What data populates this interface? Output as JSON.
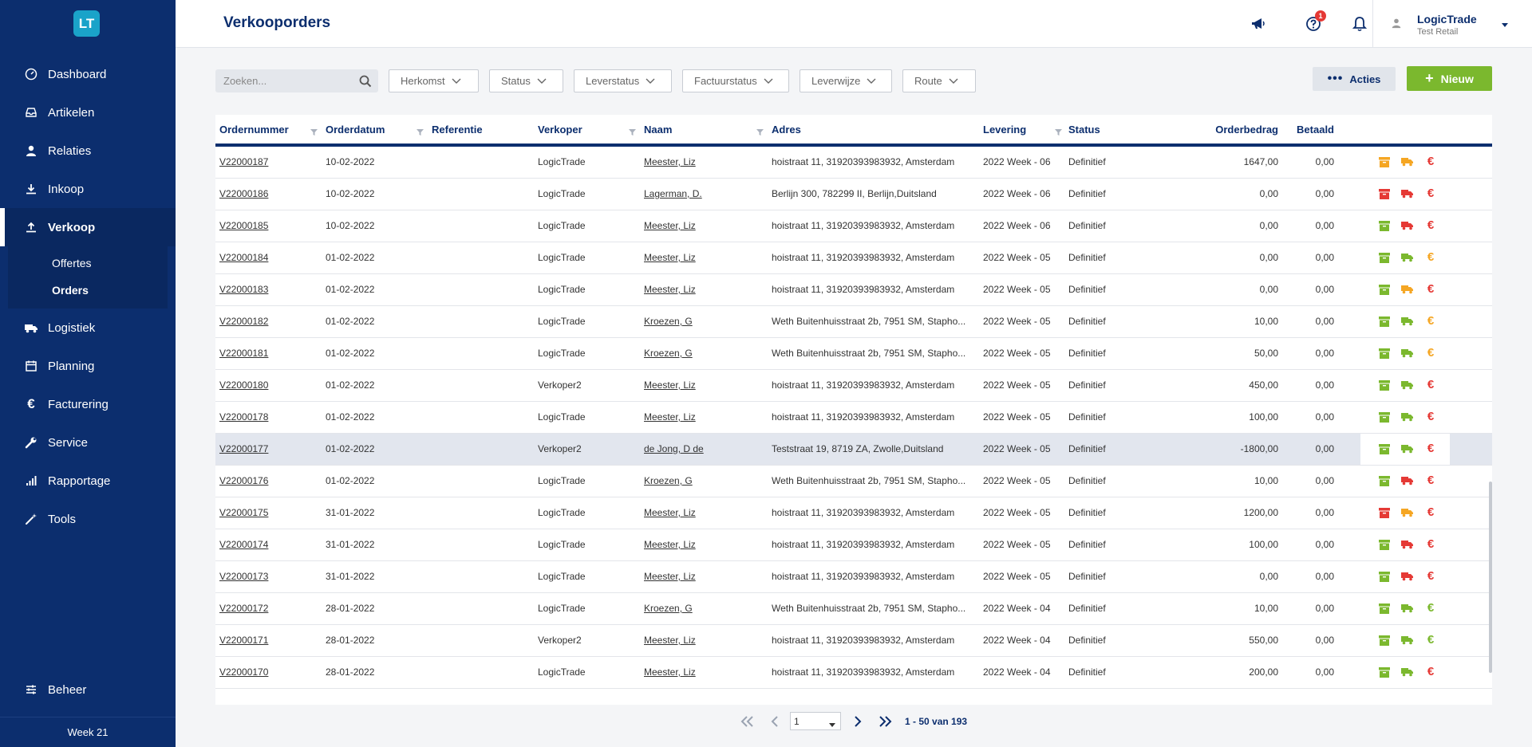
{
  "app": {
    "logo": "LT",
    "page_title": "Verkooporders",
    "week": "Week 21"
  },
  "sidebar": {
    "items": [
      {
        "label": "Dashboard",
        "icon": "dashboard-icon"
      },
      {
        "label": "Artikelen",
        "icon": "inbox-icon"
      },
      {
        "label": "Relaties",
        "icon": "user-icon"
      },
      {
        "label": "Inkoop",
        "icon": "download-icon"
      },
      {
        "label": "Verkoop",
        "icon": "upload-icon"
      }
    ],
    "sub": [
      {
        "label": "Offertes"
      },
      {
        "label": "Orders"
      }
    ],
    "items2": [
      {
        "label": "Logistiek",
        "icon": "truck-icon"
      },
      {
        "label": "Planning",
        "icon": "calendar-icon"
      },
      {
        "label": "Facturering",
        "icon": "euro-icon"
      },
      {
        "label": "Service",
        "icon": "wrench-icon"
      },
      {
        "label": "Rapportage",
        "icon": "bar-chart-icon"
      },
      {
        "label": "Tools",
        "icon": "magic-wand-icon"
      }
    ],
    "beheer": "Beheer"
  },
  "topbar": {
    "help_badge": "1",
    "user_name": "LogicTrade",
    "user_sub": "Test Retail"
  },
  "filters": {
    "search_placeholder": "Zoeken...",
    "items": [
      "Herkomst",
      "Status",
      "Leverstatus",
      "Factuurstatus",
      "Leverwijze",
      "Route"
    ],
    "acties": "Acties",
    "nieuw": "Nieuw"
  },
  "table": {
    "headers": {
      "ordernummer": "Ordernummer",
      "orderdatum": "Orderdatum",
      "referentie": "Referentie",
      "verkoper": "Verkoper",
      "naam": "Naam",
      "adres": "Adres",
      "levering": "Levering",
      "status": "Status",
      "orderbedrag": "Orderbedrag",
      "betaald": "Betaald"
    },
    "rows": [
      {
        "nr": "V22000187",
        "datum": "10-02-2022",
        "verkoper": "LogicTrade",
        "naam": "Meester, Liz",
        "adres": "hoistraat 11, 31920393983932, Amsterdam",
        "levering": "2022 Week - 06",
        "status": "Definitief",
        "bedrag": "1647,00",
        "betaald": "0,00",
        "c": [
          "#f5a623",
          "#f5a623",
          "#e53935"
        ]
      },
      {
        "nr": "V22000186",
        "datum": "10-02-2022",
        "verkoper": "LogicTrade",
        "naam": "Lagerman, D.",
        "adres": "Berlijn 300, 782299 II, Berlijn,Duitsland",
        "levering": "2022 Week - 06",
        "status": "Definitief",
        "bedrag": "0,00",
        "betaald": "0,00",
        "c": [
          "#e53935",
          "#e53935",
          "#e53935"
        ]
      },
      {
        "nr": "V22000185",
        "datum": "10-02-2022",
        "verkoper": "LogicTrade",
        "naam": "Meester, Liz",
        "adres": "hoistraat 11, 31920393983932, Amsterdam",
        "levering": "2022 Week - 06",
        "status": "Definitief",
        "bedrag": "0,00",
        "betaald": "0,00",
        "c": [
          "#7bb82e",
          "#e53935",
          "#e53935"
        ]
      },
      {
        "nr": "V22000184",
        "datum": "01-02-2022",
        "verkoper": "LogicTrade",
        "naam": "Meester, Liz",
        "adres": "hoistraat 11, 31920393983932, Amsterdam",
        "levering": "2022 Week - 05",
        "status": "Definitief",
        "bedrag": "0,00",
        "betaald": "0,00",
        "c": [
          "#7bb82e",
          "#7bb82e",
          "#f5a623"
        ]
      },
      {
        "nr": "V22000183",
        "datum": "01-02-2022",
        "verkoper": "LogicTrade",
        "naam": "Meester, Liz",
        "adres": "hoistraat 11, 31920393983932, Amsterdam",
        "levering": "2022 Week - 05",
        "status": "Definitief",
        "bedrag": "0,00",
        "betaald": "0,00",
        "c": [
          "#7bb82e",
          "#f5a623",
          "#e53935"
        ]
      },
      {
        "nr": "V22000182",
        "datum": "01-02-2022",
        "verkoper": "LogicTrade",
        "naam": "Kroezen, G",
        "adres": "Weth Buitenhuisstraat 2b, 7951 SM, Stapho...",
        "levering": "2022 Week - 05",
        "status": "Definitief",
        "bedrag": "10,00",
        "betaald": "0,00",
        "c": [
          "#7bb82e",
          "#7bb82e",
          "#f5a623"
        ]
      },
      {
        "nr": "V22000181",
        "datum": "01-02-2022",
        "verkoper": "LogicTrade",
        "naam": "Kroezen, G",
        "adres": "Weth Buitenhuisstraat 2b, 7951 SM, Stapho...",
        "levering": "2022 Week - 05",
        "status": "Definitief",
        "bedrag": "50,00",
        "betaald": "0,00",
        "c": [
          "#7bb82e",
          "#7bb82e",
          "#f5a623"
        ]
      },
      {
        "nr": "V22000180",
        "datum": "01-02-2022",
        "verkoper": "Verkoper2",
        "naam": "Meester, Liz",
        "adres": "hoistraat 11, 31920393983932, Amsterdam",
        "levering": "2022 Week - 05",
        "status": "Definitief",
        "bedrag": "450,00",
        "betaald": "0,00",
        "c": [
          "#7bb82e",
          "#7bb82e",
          "#e53935"
        ]
      },
      {
        "nr": "V22000178",
        "datum": "01-02-2022",
        "verkoper": "LogicTrade",
        "naam": "Meester, Liz",
        "adres": "hoistraat 11, 31920393983932, Amsterdam",
        "levering": "2022 Week - 05",
        "status": "Definitief",
        "bedrag": "100,00",
        "betaald": "0,00",
        "c": [
          "#7bb82e",
          "#7bb82e",
          "#e53935"
        ]
      },
      {
        "nr": "V22000177",
        "datum": "01-02-2022",
        "verkoper": "Verkoper2",
        "naam": "de Jong, D de",
        "adres": "Teststraat 19, 8719 ZA, Zwolle,Duitsland",
        "levering": "2022 Week - 05",
        "status": "Definitief",
        "bedrag": "-1800,00",
        "betaald": "0,00",
        "c": [
          "#7bb82e",
          "#7bb82e",
          "#e53935"
        ],
        "hl": true
      },
      {
        "nr": "V22000176",
        "datum": "01-02-2022",
        "verkoper": "LogicTrade",
        "naam": "Kroezen, G",
        "adres": "Weth Buitenhuisstraat 2b, 7951 SM, Stapho...",
        "levering": "2022 Week - 05",
        "status": "Definitief",
        "bedrag": "10,00",
        "betaald": "0,00",
        "c": [
          "#7bb82e",
          "#e53935",
          "#e53935"
        ]
      },
      {
        "nr": "V22000175",
        "datum": "31-01-2022",
        "verkoper": "LogicTrade",
        "naam": "Meester, Liz",
        "adres": "hoistraat 11, 31920393983932, Amsterdam",
        "levering": "2022 Week - 05",
        "status": "Definitief",
        "bedrag": "1200,00",
        "betaald": "0,00",
        "c": [
          "#e53935",
          "#f5a623",
          "#e53935"
        ]
      },
      {
        "nr": "V22000174",
        "datum": "31-01-2022",
        "verkoper": "LogicTrade",
        "naam": "Meester, Liz",
        "adres": "hoistraat 11, 31920393983932, Amsterdam",
        "levering": "2022 Week - 05",
        "status": "Definitief",
        "bedrag": "100,00",
        "betaald": "0,00",
        "c": [
          "#7bb82e",
          "#e53935",
          "#e53935"
        ]
      },
      {
        "nr": "V22000173",
        "datum": "31-01-2022",
        "verkoper": "LogicTrade",
        "naam": "Meester, Liz",
        "adres": "hoistraat 11, 31920393983932, Amsterdam",
        "levering": "2022 Week - 05",
        "status": "Definitief",
        "bedrag": "0,00",
        "betaald": "0,00",
        "c": [
          "#7bb82e",
          "#e53935",
          "#e53935"
        ]
      },
      {
        "nr": "V22000172",
        "datum": "28-01-2022",
        "verkoper": "LogicTrade",
        "naam": "Kroezen, G",
        "adres": "Weth Buitenhuisstraat 2b, 7951 SM, Stapho...",
        "levering": "2022 Week - 04",
        "status": "Definitief",
        "bedrag": "10,00",
        "betaald": "0,00",
        "c": [
          "#7bb82e",
          "#7bb82e",
          "#7bb82e"
        ]
      },
      {
        "nr": "V22000171",
        "datum": "28-01-2022",
        "verkoper": "Verkoper2",
        "naam": "Meester, Liz",
        "adres": "hoistraat 11, 31920393983932, Amsterdam",
        "levering": "2022 Week - 04",
        "status": "Definitief",
        "bedrag": "550,00",
        "betaald": "0,00",
        "c": [
          "#7bb82e",
          "#7bb82e",
          "#7bb82e"
        ]
      },
      {
        "nr": "V22000170",
        "datum": "28-01-2022",
        "verkoper": "LogicTrade",
        "naam": "Meester, Liz",
        "adres": "hoistraat 11, 31920393983932, Amsterdam",
        "levering": "2022 Week - 04",
        "status": "Definitief",
        "bedrag": "200,00",
        "betaald": "0,00",
        "c": [
          "#7bb82e",
          "#7bb82e",
          "#e53935"
        ]
      }
    ]
  },
  "pagination": {
    "page": "1",
    "info": "1 - 50 van 193"
  },
  "colors": {
    "primary": "#0c2e6e",
    "accent_green": "#7bb82e",
    "orange": "#f5a623",
    "red": "#e53935"
  }
}
